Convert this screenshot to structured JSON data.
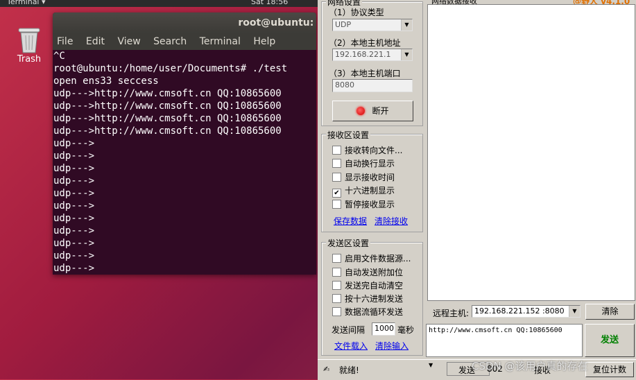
{
  "topbar": {
    "app_name": "Terminal ▾",
    "clock": "Sat 18:56"
  },
  "desktop": {
    "trash_label": "Trash"
  },
  "terminal": {
    "title": "root@ubuntu: /home",
    "menu": [
      "File",
      "Edit",
      "View",
      "Search",
      "Terminal",
      "Help"
    ],
    "lines": [
      "^C",
      "root@ubuntu:/home/user/Documents# ./test",
      "open ens33 seccess",
      "udp--->http://www.cmsoft.cn QQ:10865600",
      "udp--->http://www.cmsoft.cn QQ:10865600",
      "udp--->http://www.cmsoft.cn QQ:10865600",
      "udp--->http://www.cmsoft.cn QQ:10865600",
      "udp--->",
      "udp--->",
      "udp--->",
      "udp--->",
      "udp--->",
      "udp--->",
      "udp--->",
      "udp--->",
      "udp--->",
      "udp--->",
      "udp--->"
    ]
  },
  "tool": {
    "net_group_caption": "网络设置",
    "recv_header": "网络数据接收",
    "version": "@野人 v4.1.0",
    "protocol_label": "（1）协议类型",
    "protocol_value": "UDP",
    "local_addr_label": "（2）本地主机地址",
    "local_addr_value": "192.168.221.1",
    "local_port_label": "（3）本地主机端口",
    "local_port_value": "8080",
    "disconnect_button": "断开",
    "recv_group": "接收区设置",
    "recv_options": [
      {
        "label": "接收转向文件...",
        "checked": ""
      },
      {
        "label": "自动换行显示",
        "checked": ""
      },
      {
        "label": "显示接收时间",
        "checked": ""
      },
      {
        "label": "十六进制显示",
        "checked": "✔"
      },
      {
        "label": "暂停接收显示",
        "checked": ""
      }
    ],
    "save_data": "保存数据",
    "clear_recv": "清除接收",
    "send_group": "发送区设置",
    "send_options": [
      {
        "label": "启用文件数据源...",
        "checked": ""
      },
      {
        "label": "自动发送附加位",
        "checked": ""
      },
      {
        "label": "发送完自动清空",
        "checked": ""
      },
      {
        "label": "按十六进制发送",
        "checked": ""
      },
      {
        "label": "数据流循环发送",
        "checked": ""
      }
    ],
    "interval_label": "发送间隔",
    "interval_value": "1000",
    "interval_unit": "毫秒",
    "file_load": "文件载入",
    "clear_input": "清除输入",
    "remote_label": "远程主机:",
    "remote_value": "192.168.221.152 :8080",
    "clear_button": "清除",
    "send_text": "http://www.cmsoft.cn QQ:10865600",
    "send_button": "发送",
    "status_ready": "就绪!",
    "status_send": "发送",
    "status_count": "802",
    "status_recv": "接收",
    "reset_count": "复位计数"
  },
  "watermark": "CSDN @该用户真的存在"
}
